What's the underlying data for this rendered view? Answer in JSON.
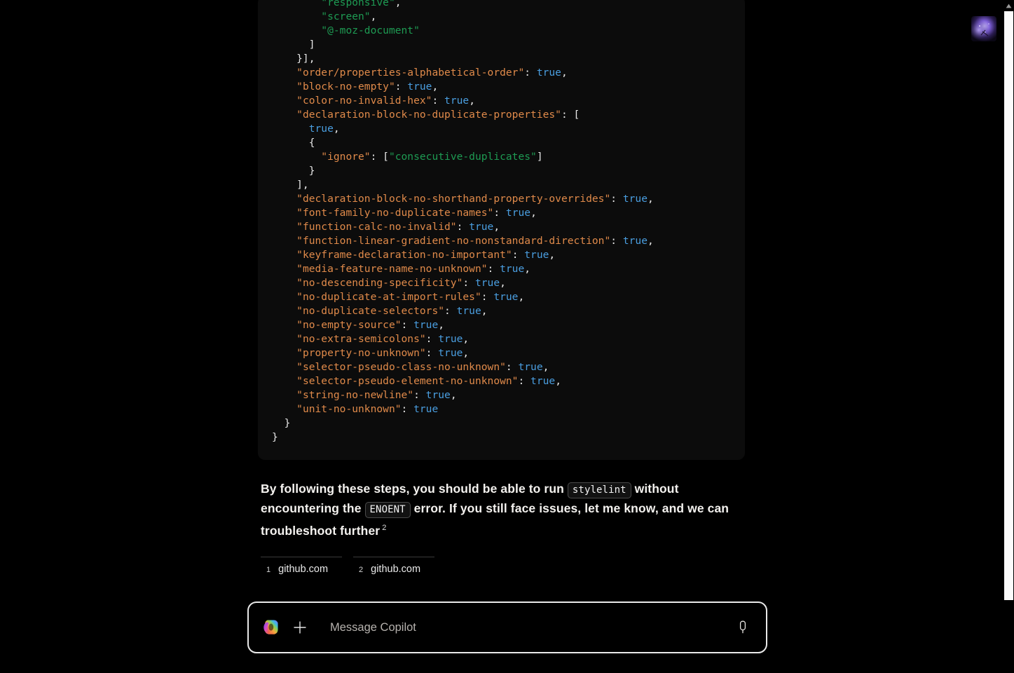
{
  "window": {
    "background_color": "#000000",
    "accent_color": "#e9e9e9"
  },
  "avatar": {
    "name": "user-avatar",
    "description": "purple nebula image"
  },
  "scrollbar": {
    "up_arrow_glyph": "▲",
    "thumb_color": "#fbfbfb"
  },
  "code_block": {
    "language": "json",
    "lines": [
      [
        {
          "t": "        ",
          "c": "plain"
        },
        {
          "t": "\"responsive\"",
          "c": "str"
        },
        {
          "t": ",",
          "c": "punct"
        }
      ],
      [
        {
          "t": "        ",
          "c": "plain"
        },
        {
          "t": "\"screen\"",
          "c": "str"
        },
        {
          "t": ",",
          "c": "punct"
        }
      ],
      [
        {
          "t": "        ",
          "c": "plain"
        },
        {
          "t": "\"@-moz-document\"",
          "c": "str"
        }
      ],
      [
        {
          "t": "      ]",
          "c": "plain"
        }
      ],
      [
        {
          "t": "    }],",
          "c": "plain"
        }
      ],
      [
        {
          "t": "    ",
          "c": "plain"
        },
        {
          "t": "\"order/properties-alphabetical-order\"",
          "c": "key"
        },
        {
          "t": ": ",
          "c": "punct"
        },
        {
          "t": "true",
          "c": "bool"
        },
        {
          "t": ",",
          "c": "punct"
        }
      ],
      [
        {
          "t": "    ",
          "c": "plain"
        },
        {
          "t": "\"block-no-empty\"",
          "c": "key"
        },
        {
          "t": ": ",
          "c": "punct"
        },
        {
          "t": "true",
          "c": "bool"
        },
        {
          "t": ",",
          "c": "punct"
        }
      ],
      [
        {
          "t": "    ",
          "c": "plain"
        },
        {
          "t": "\"color-no-invalid-hex\"",
          "c": "key"
        },
        {
          "t": ": ",
          "c": "punct"
        },
        {
          "t": "true",
          "c": "bool"
        },
        {
          "t": ",",
          "c": "punct"
        }
      ],
      [
        {
          "t": "    ",
          "c": "plain"
        },
        {
          "t": "\"declaration-block-no-duplicate-properties\"",
          "c": "key"
        },
        {
          "t": ": [",
          "c": "punct"
        }
      ],
      [
        {
          "t": "      ",
          "c": "plain"
        },
        {
          "t": "true",
          "c": "bool"
        },
        {
          "t": ",",
          "c": "punct"
        }
      ],
      [
        {
          "t": "      {",
          "c": "plain"
        }
      ],
      [
        {
          "t": "        ",
          "c": "plain"
        },
        {
          "t": "\"ignore\"",
          "c": "key"
        },
        {
          "t": ": [",
          "c": "punct"
        },
        {
          "t": "\"consecutive-duplicates\"",
          "c": "str"
        },
        {
          "t": "]",
          "c": "punct"
        }
      ],
      [
        {
          "t": "      }",
          "c": "plain"
        }
      ],
      [
        {
          "t": "    ],",
          "c": "plain"
        }
      ],
      [
        {
          "t": "    ",
          "c": "plain"
        },
        {
          "t": "\"declaration-block-no-shorthand-property-overrides\"",
          "c": "key"
        },
        {
          "t": ": ",
          "c": "punct"
        },
        {
          "t": "true",
          "c": "bool"
        },
        {
          "t": ",",
          "c": "punct"
        }
      ],
      [
        {
          "t": "    ",
          "c": "plain"
        },
        {
          "t": "\"font-family-no-duplicate-names\"",
          "c": "key"
        },
        {
          "t": ": ",
          "c": "punct"
        },
        {
          "t": "true",
          "c": "bool"
        },
        {
          "t": ",",
          "c": "punct"
        }
      ],
      [
        {
          "t": "    ",
          "c": "plain"
        },
        {
          "t": "\"function-calc-no-invalid\"",
          "c": "key"
        },
        {
          "t": ": ",
          "c": "punct"
        },
        {
          "t": "true",
          "c": "bool"
        },
        {
          "t": ",",
          "c": "punct"
        }
      ],
      [
        {
          "t": "    ",
          "c": "plain"
        },
        {
          "t": "\"function-linear-gradient-no-nonstandard-direction\"",
          "c": "key"
        },
        {
          "t": ": ",
          "c": "punct"
        },
        {
          "t": "true",
          "c": "bool"
        },
        {
          "t": ",",
          "c": "punct"
        }
      ],
      [
        {
          "t": "    ",
          "c": "plain"
        },
        {
          "t": "\"keyframe-declaration-no-important\"",
          "c": "key"
        },
        {
          "t": ": ",
          "c": "punct"
        },
        {
          "t": "true",
          "c": "bool"
        },
        {
          "t": ",",
          "c": "punct"
        }
      ],
      [
        {
          "t": "    ",
          "c": "plain"
        },
        {
          "t": "\"media-feature-name-no-unknown\"",
          "c": "key"
        },
        {
          "t": ": ",
          "c": "punct"
        },
        {
          "t": "true",
          "c": "bool"
        },
        {
          "t": ",",
          "c": "punct"
        }
      ],
      [
        {
          "t": "    ",
          "c": "plain"
        },
        {
          "t": "\"no-descending-specificity\"",
          "c": "key"
        },
        {
          "t": ": ",
          "c": "punct"
        },
        {
          "t": "true",
          "c": "bool"
        },
        {
          "t": ",",
          "c": "punct"
        }
      ],
      [
        {
          "t": "    ",
          "c": "plain"
        },
        {
          "t": "\"no-duplicate-at-import-rules\"",
          "c": "key"
        },
        {
          "t": ": ",
          "c": "punct"
        },
        {
          "t": "true",
          "c": "bool"
        },
        {
          "t": ",",
          "c": "punct"
        }
      ],
      [
        {
          "t": "    ",
          "c": "plain"
        },
        {
          "t": "\"no-duplicate-selectors\"",
          "c": "key"
        },
        {
          "t": ": ",
          "c": "punct"
        },
        {
          "t": "true",
          "c": "bool"
        },
        {
          "t": ",",
          "c": "punct"
        }
      ],
      [
        {
          "t": "    ",
          "c": "plain"
        },
        {
          "t": "\"no-empty-source\"",
          "c": "key"
        },
        {
          "t": ": ",
          "c": "punct"
        },
        {
          "t": "true",
          "c": "bool"
        },
        {
          "t": ",",
          "c": "punct"
        }
      ],
      [
        {
          "t": "    ",
          "c": "plain"
        },
        {
          "t": "\"no-extra-semicolons\"",
          "c": "key"
        },
        {
          "t": ": ",
          "c": "punct"
        },
        {
          "t": "true",
          "c": "bool"
        },
        {
          "t": ",",
          "c": "punct"
        }
      ],
      [
        {
          "t": "    ",
          "c": "plain"
        },
        {
          "t": "\"property-no-unknown\"",
          "c": "key"
        },
        {
          "t": ": ",
          "c": "punct"
        },
        {
          "t": "true",
          "c": "bool"
        },
        {
          "t": ",",
          "c": "punct"
        }
      ],
      [
        {
          "t": "    ",
          "c": "plain"
        },
        {
          "t": "\"selector-pseudo-class-no-unknown\"",
          "c": "key"
        },
        {
          "t": ": ",
          "c": "punct"
        },
        {
          "t": "true",
          "c": "bool"
        },
        {
          "t": ",",
          "c": "punct"
        }
      ],
      [
        {
          "t": "    ",
          "c": "plain"
        },
        {
          "t": "\"selector-pseudo-element-no-unknown\"",
          "c": "key"
        },
        {
          "t": ": ",
          "c": "punct"
        },
        {
          "t": "true",
          "c": "bool"
        },
        {
          "t": ",",
          "c": "punct"
        }
      ],
      [
        {
          "t": "    ",
          "c": "plain"
        },
        {
          "t": "\"string-no-newline\"",
          "c": "key"
        },
        {
          "t": ": ",
          "c": "punct"
        },
        {
          "t": "true",
          "c": "bool"
        },
        {
          "t": ",",
          "c": "punct"
        }
      ],
      [
        {
          "t": "    ",
          "c": "plain"
        },
        {
          "t": "\"unit-no-unknown\"",
          "c": "key"
        },
        {
          "t": ": ",
          "c": "punct"
        },
        {
          "t": "true",
          "c": "bool"
        }
      ],
      [
        {
          "t": "  }",
          "c": "plain"
        }
      ],
      [
        {
          "t": "}",
          "c": "plain"
        }
      ]
    ],
    "colors": {
      "key": "#e08a4a",
      "string": "#1e9b53",
      "boolean": "#4a9ee0",
      "punctuation": "#e8e8e8",
      "background": "#0c0c0c"
    }
  },
  "answer": {
    "part1": "By following these steps, you should be able to run ",
    "code1": "stylelint",
    "part2": " without encountering the ",
    "code2": "ENOENT",
    "part3": " error. If you still face issues, let me know, and we can troubleshoot further",
    "citation_marker": "2"
  },
  "citations": [
    {
      "number": "1",
      "domain": "github.com"
    },
    {
      "number": "2",
      "domain": "github.com"
    }
  ],
  "composer": {
    "placeholder": "Message Copilot",
    "value": "",
    "logo_name": "copilot-logo",
    "add_label": "+",
    "mic_label": "microphone"
  }
}
